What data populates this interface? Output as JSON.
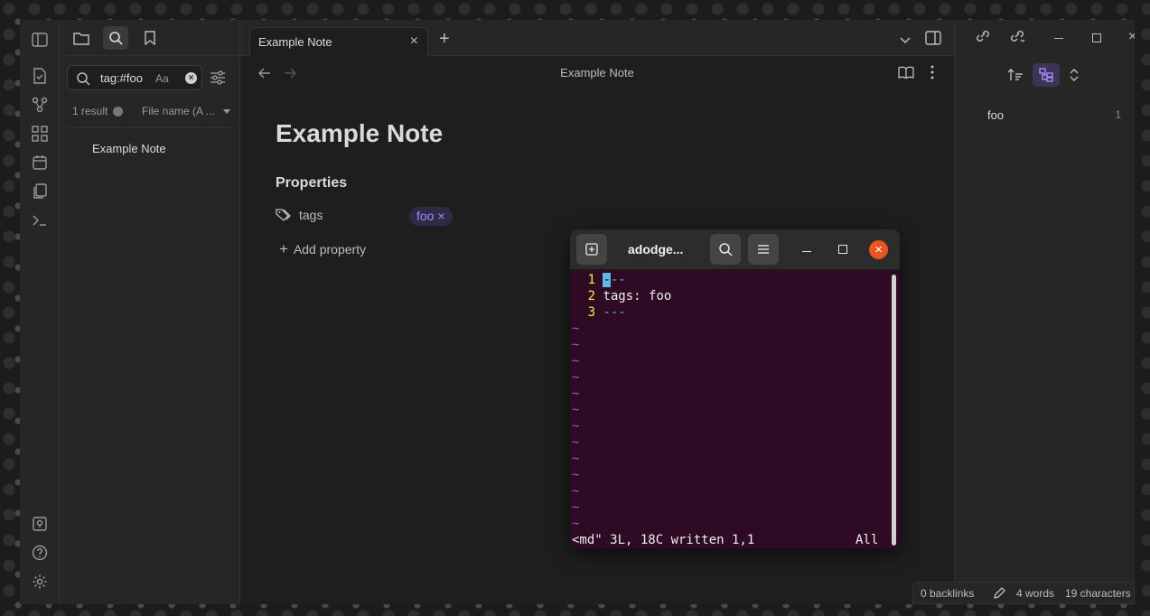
{
  "left_pane": {
    "search_query": "tag:#foo",
    "match_case_label": "Aa",
    "results_count": "1 result",
    "sort_label": "File name (A ...",
    "result_item": "Example Note"
  },
  "tab": {
    "title": "Example Note"
  },
  "view_header": {
    "title": "Example Note"
  },
  "note": {
    "title": "Example Note",
    "properties_heading": "Properties",
    "prop_key": "tags",
    "prop_value": "foo",
    "add_property": "Add property"
  },
  "right_pane": {
    "tag": "foo",
    "count": "1"
  },
  "status_bar": {
    "backlinks": "0 backlinks",
    "words": "4 words",
    "characters": "19 characters"
  },
  "terminal": {
    "title": "adodge...",
    "lines": [
      {
        "num": "1",
        "text": "---"
      },
      {
        "num": "2",
        "text": "tags: foo"
      },
      {
        "num": "3",
        "text": "---"
      }
    ],
    "status": "<md\" 3L, 18C written 1,1",
    "position": "All"
  },
  "colors": {
    "accent": "#a68af9",
    "terminal_bg": "#2f0a24",
    "close_button": "#e95420"
  }
}
